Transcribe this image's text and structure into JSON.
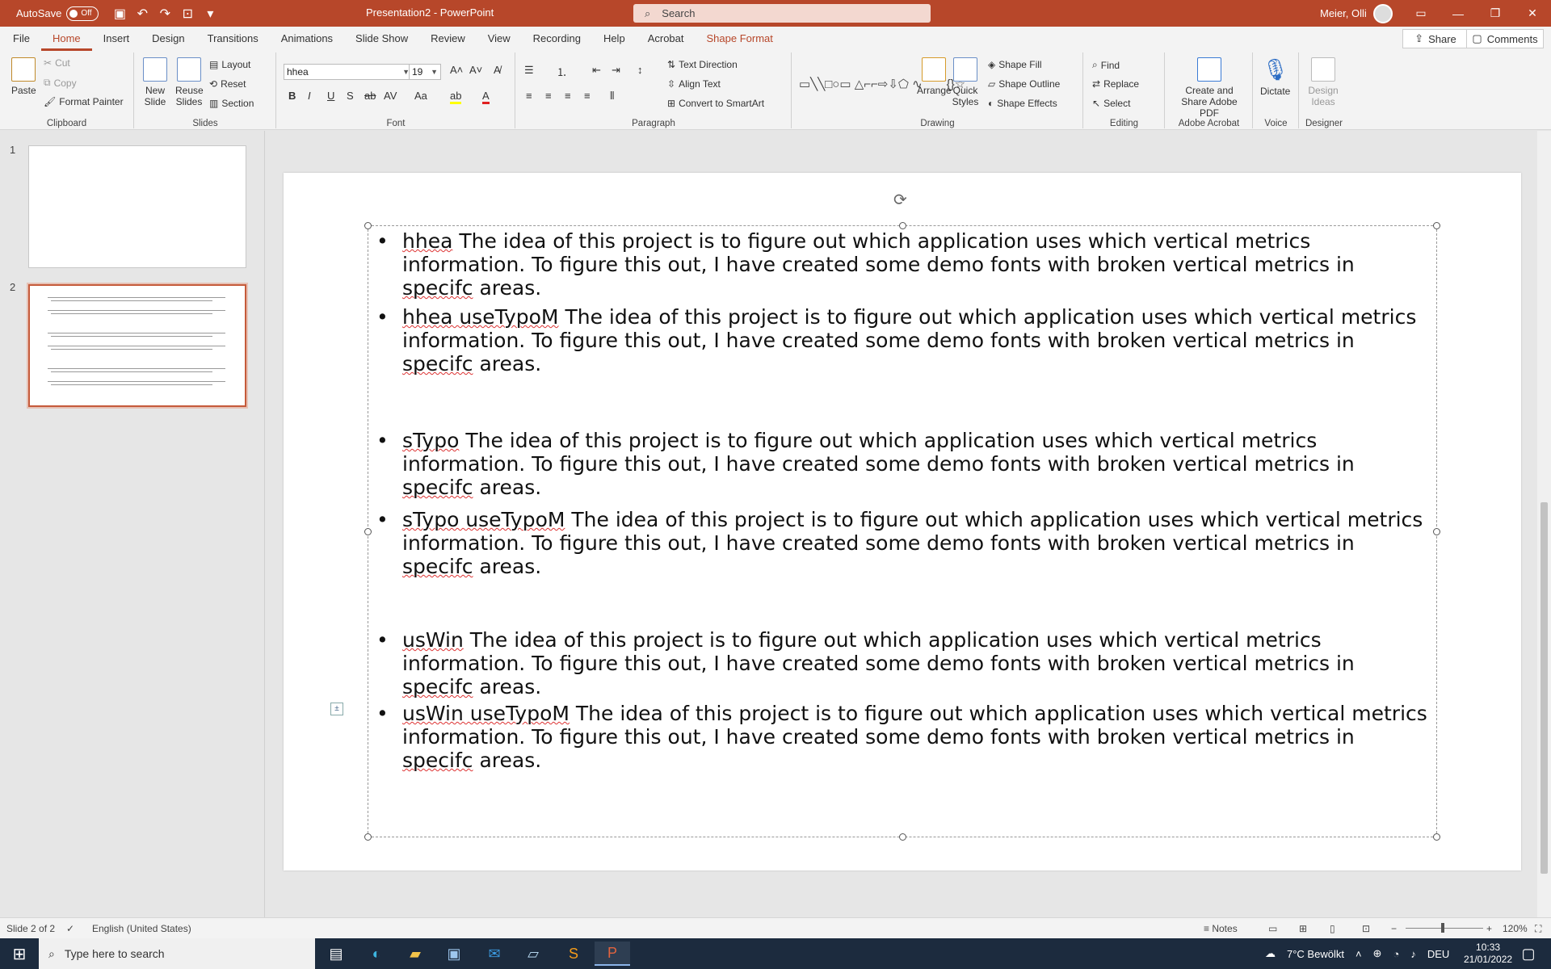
{
  "titlebar": {
    "autosave_label": "AutoSave",
    "autosave_state": "Off",
    "doc_title": "Presentation2 - PowerPoint",
    "search_placeholder": "Search",
    "user_name": "Meier, Olli"
  },
  "menu": {
    "tabs": [
      "File",
      "Home",
      "Insert",
      "Design",
      "Transitions",
      "Animations",
      "Slide Show",
      "Review",
      "View",
      "Recording",
      "Help",
      "Acrobat",
      "Shape Format"
    ],
    "share": "Share",
    "comments": "Comments"
  },
  "ribbon": {
    "clipboard": {
      "label": "Clipboard",
      "paste": "Paste",
      "cut": "Cut",
      "copy": "Copy",
      "format_painter": "Format Painter"
    },
    "slides": {
      "label": "Slides",
      "new_slide": "New Slide",
      "reuse_slides": "Reuse Slides",
      "layout": "Layout",
      "reset": "Reset",
      "section": "Section"
    },
    "font": {
      "label": "Font",
      "font_name": "hhea",
      "font_size": "19"
    },
    "paragraph": {
      "label": "Paragraph",
      "text_direction": "Text Direction",
      "align_text": "Align Text",
      "convert_smartart": "Convert to SmartArt"
    },
    "drawing": {
      "label": "Drawing",
      "arrange": "Arrange",
      "quick_styles": "Quick Styles",
      "shape_fill": "Shape Fill",
      "shape_outline": "Shape Outline",
      "shape_effects": "Shape Effects"
    },
    "editing": {
      "label": "Editing",
      "find": "Find",
      "replace": "Replace",
      "select": "Select"
    },
    "acrobat": {
      "label": "Adobe Acrobat",
      "create_share": "Create and Share Adobe PDF"
    },
    "voice": {
      "label": "Voice",
      "dictate": "Dictate"
    },
    "designer": {
      "label": "Designer",
      "design_ideas": "Design Ideas"
    }
  },
  "thumbnails": {
    "slide1": "1",
    "slide2": "2"
  },
  "slide": {
    "bullets": [
      {
        "key": "hhea",
        "rest": " The idea of this project is to figure out which application uses which vertical metrics information. To figure this out, I have created some demo fonts with broken vertical metrics in ",
        "sq": "specifc",
        "end": " areas."
      },
      {
        "key": "hhea useTypoM",
        "rest": " The idea of this project is to figure out which application uses which vertical metrics information. To figure this out, I have created some demo fonts with broken vertical metrics in ",
        "sq": "specifc",
        "end": " areas."
      },
      {
        "key": "sTypo",
        "rest": " The idea of this project is to figure out which application uses which vertical metrics information. To figure this out, I have created some demo fonts with broken vertical metrics in ",
        "sq": "specifc",
        "end": " areas."
      },
      {
        "key": "sTypo useTypoM",
        "rest": " The idea of this project is to figure out which application uses which vertical metrics information. To figure this out, I have created some demo fonts with broken vertical metrics in ",
        "sq": "specifc",
        "end": " areas."
      },
      {
        "key": "usWin",
        "rest": " The idea of this project is to figure out which application uses which vertical metrics information. To figure this out, I have created some demo fonts with broken vertical metrics in ",
        "sq": "specifc",
        "end": " areas."
      },
      {
        "key": "usWin useTypoM",
        "rest": " The idea of this project is to figure out which application uses which vertical metrics information. To figure this out, I have created some demo fonts with broken vertical metrics in ",
        "sq": "specifc",
        "end": " areas."
      }
    ]
  },
  "status": {
    "slide_count": "Slide 2 of 2",
    "language": "English (United States)",
    "notes": "Notes",
    "zoom": "120%"
  },
  "taskbar": {
    "search_placeholder": "Type here to search",
    "weather": "7°C Bewölkt",
    "lang": "DEU",
    "time": "10:33",
    "date": "21/01/2022"
  }
}
